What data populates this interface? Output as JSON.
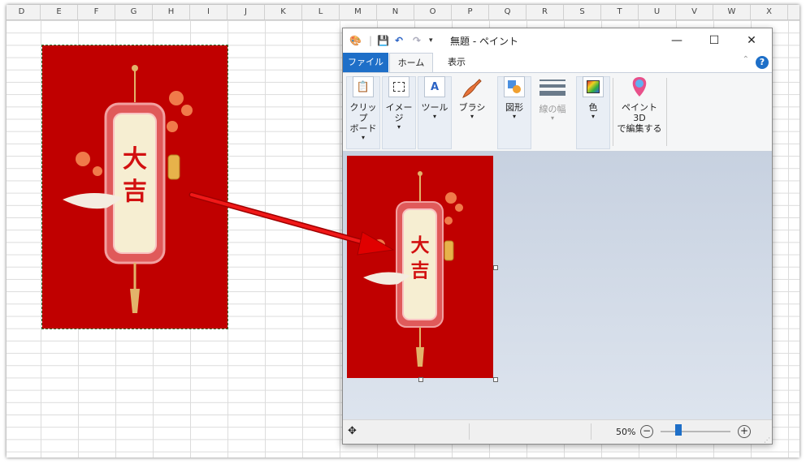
{
  "spreadsheet": {
    "columns": [
      "D",
      "E",
      "F",
      "G",
      "H",
      "I",
      "J",
      "K",
      "L",
      "M",
      "N",
      "O",
      "P",
      "Q",
      "R",
      "S",
      "T",
      "U",
      "V",
      "W",
      "X"
    ]
  },
  "poster": {
    "characters": [
      "大",
      "吉"
    ],
    "background_color": "#c00000"
  },
  "paint": {
    "title": "無題 - ペイント",
    "window_controls": {
      "minimize": "—",
      "maximize": "☐",
      "close": "✕"
    },
    "menu": {
      "file": "ファイル",
      "home": "ホーム",
      "view": "表示",
      "help": "?"
    },
    "ribbon": [
      {
        "name": "clipboard",
        "label1": "クリップ",
        "label2": "ボード",
        "icon": "clipboard-icon",
        "dropdown": "▾"
      },
      {
        "name": "image",
        "label1": "イメージ",
        "label2": "",
        "icon": "select-icon",
        "dropdown": "▾"
      },
      {
        "name": "tools",
        "label1": "ツール",
        "label2": "",
        "icon": "tools-icon",
        "dropdown": "▾"
      },
      {
        "name": "brushes",
        "label1": "ブラシ",
        "label2": "",
        "icon": "brush-icon",
        "dropdown": "▾"
      },
      {
        "name": "shapes",
        "label1": "図形",
        "label2": "",
        "icon": "shapes-icon",
        "dropdown": "▾"
      },
      {
        "name": "size",
        "label1": "線の幅",
        "label2": "",
        "icon": "line-width-icon",
        "dropdown": "▾"
      },
      {
        "name": "colors",
        "label1": "色",
        "label2": "",
        "icon": "colors-icon",
        "dropdown": "▾"
      },
      {
        "name": "paint3d",
        "label1": "ペイント 3D",
        "label2": "で編集する",
        "icon": "paint3d-icon",
        "dropdown": ""
      }
    ],
    "status": {
      "zoom": "50%",
      "zoom_fraction": 0.25,
      "minus": "−",
      "plus": "+"
    },
    "accent_color": "#1e6fc8",
    "canvas_bg": "#c9d3e2"
  }
}
